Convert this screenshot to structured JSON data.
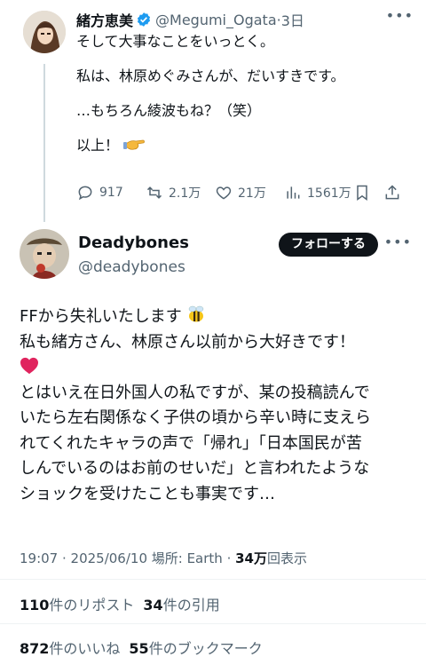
{
  "tweet1": {
    "name": "緒方恵美",
    "handle": "@Megumi_Ogata",
    "time": "3日",
    "lines": [
      "そして大事なことをいっとく。",
      "私は、林原めぐみさんが、だいすきです。",
      "…もちろん綾波もね？（笑）",
      "以上！"
    ],
    "actions": {
      "replies": "917",
      "reposts": "2.1万",
      "likes": "21万",
      "views": "1561万"
    }
  },
  "tweet2": {
    "name": "Deadybones",
    "handle": "@deadybones",
    "follow_label": "フォローする",
    "lines": [
      "FFから失礼いたします",
      "私も緒方さん、林原さん以前から大好きです！",
      "とはいえ在日外国人の私ですが、某の投稿読んで",
      "いたら左右関係なく子供の頃から辛い時に支えら",
      "れてくれたキャラの声で「帰れ」「日本国民が苦",
      "しんでいるのはお前のせいだ」と言われたような",
      "ショックを受けたことも事実です…"
    ],
    "meta_prefix": "19:07 · 2025/06/10 場所: Earth · ",
    "views_count": "34万",
    "views_label": "回表示",
    "reposts_count": "110",
    "reposts_label": "件のリポスト",
    "quotes_count": "34",
    "quotes_label": "件の引用",
    "likes_count": "872",
    "likes_label": "件のいいね",
    "bookmarks_count": "55",
    "bookmarks_label": "件のブックマーク"
  },
  "icons": [
    "verified-badge-icon",
    "more-icon",
    "reply-icon",
    "repost-icon",
    "like-icon",
    "views-icon",
    "bookmark-icon",
    "share-icon",
    "pointing-hand-emoji",
    "bee-emoji",
    "red-heart-emoji"
  ],
  "colors": {
    "text": "#0f1419",
    "muted": "#536471",
    "verified": "#1d9bf0",
    "heart": "#e0245e",
    "follow_bg": "#0f1419"
  }
}
